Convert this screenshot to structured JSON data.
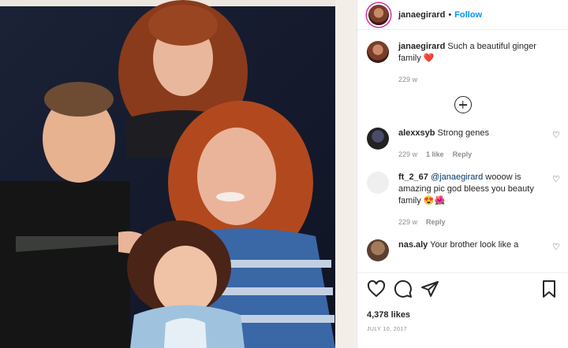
{
  "post": {
    "username": "janaegirard",
    "separator": "•",
    "follow_label": "Follow"
  },
  "caption": {
    "username": "janaegirard",
    "text": "Such a beautiful ginger family",
    "emoji": "❤️",
    "age": "229 w"
  },
  "comments": [
    {
      "username": "alexxsyb",
      "text": "Strong genes",
      "age": "229 w",
      "likes": "1 like",
      "reply": "Reply"
    },
    {
      "username": "ft_2_67",
      "mention": "@janaegirard",
      "text": "wooow is amazing pic god bleess you beauty family",
      "emoji": "😍🌺",
      "age": "229 w",
      "reply": "Reply"
    },
    {
      "username": "nas.aly",
      "text": "Your brother look like a"
    }
  ],
  "icons": {
    "like": "heart-icon",
    "comment": "comment-icon",
    "share": "share-icon",
    "save": "bookmark-icon",
    "load_more": "plus-circle-icon"
  },
  "footer": {
    "likes": "4,378 likes",
    "date": "JULY 10, 2017"
  },
  "colors": {
    "link": "#0095f6",
    "heart": "#ed4956"
  }
}
